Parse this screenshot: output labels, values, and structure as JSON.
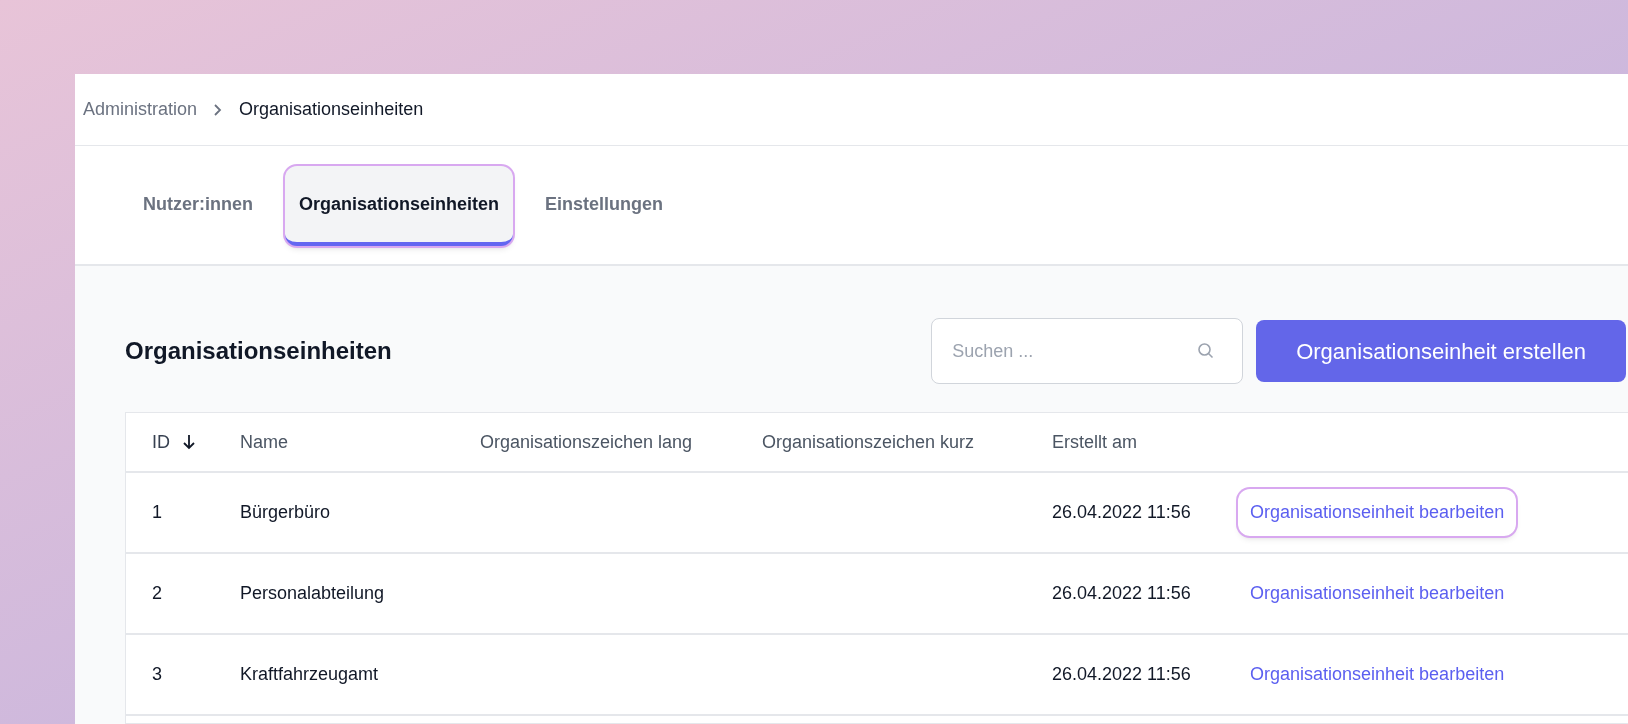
{
  "breadcrumb": [
    {
      "label": "Administration",
      "current": false
    },
    {
      "label": "Organisationseinheiten",
      "current": true
    }
  ],
  "tabs": [
    {
      "label": "Nutzer:innen",
      "selected": false,
      "highlighted": false
    },
    {
      "label": "Organisationseinheiten",
      "selected": true,
      "highlighted": true
    },
    {
      "label": "Einstellungen",
      "selected": false,
      "highlighted": false
    }
  ],
  "heading": "Organisationseinheiten",
  "search": {
    "placeholder": "Suchen ..."
  },
  "create_button": "Organisationseinheit erstellen",
  "table": {
    "columns": [
      {
        "label": "ID",
        "sorted": true
      },
      {
        "label": "Name",
        "sorted": false
      },
      {
        "label": "Organisationszeichen lang",
        "sorted": false
      },
      {
        "label": "Organisationszeichen kurz",
        "sorted": false
      },
      {
        "label": "Erstellt am",
        "sorted": false
      }
    ],
    "rows": [
      {
        "id": "1",
        "name": "Bürgerbüro",
        "created": "26.04.2022 11:56",
        "action": "Organisationseinheit bearbeiten",
        "highlighted": true
      },
      {
        "id": "2",
        "name": "Personalabteilung",
        "created": "26.04.2022 11:56",
        "action": "Organisationseinheit bearbeiten",
        "highlighted": false
      },
      {
        "id": "3",
        "name": "Kraftfahrzeugamt",
        "created": "26.04.2022 11:56",
        "action": "Organisationseinheit bearbeiten",
        "highlighted": false
      }
    ]
  }
}
